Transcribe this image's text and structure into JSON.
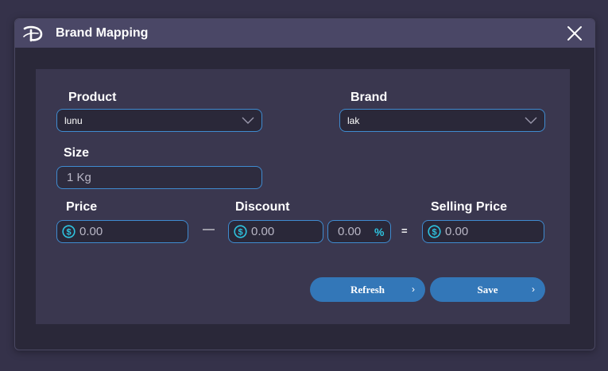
{
  "window": {
    "title": "Brand Mapping"
  },
  "form": {
    "product_label": "Product",
    "product_value": "lunu",
    "brand_label": "Brand",
    "brand_value": "lak",
    "size_label": "Size",
    "size_value": "1 Kg",
    "price_label": "Price",
    "price_value": "0.00",
    "minus_symbol": "—",
    "discount_label": "Discount",
    "discount_value": "0.00",
    "discount_percent_value": "0.00",
    "percent_symbol": "%",
    "equals_symbol": "=",
    "selling_price_label": "Selling Price",
    "selling_price_value": "0.00"
  },
  "buttons": {
    "refresh_label": "Refresh",
    "save_label": "Save",
    "chevron": "›"
  },
  "icons": {
    "logo": "disney-d-logo-icon",
    "close": "close-icon",
    "dropdown": "chevron-down-icon",
    "currency": "dollar-circle-icon"
  },
  "colors": {
    "accent_border": "#3f8bd0",
    "button": "#3377b8",
    "currency_icon": "#2ec4e0",
    "titlebar": "#4a4766",
    "panel": "#3a374f"
  }
}
